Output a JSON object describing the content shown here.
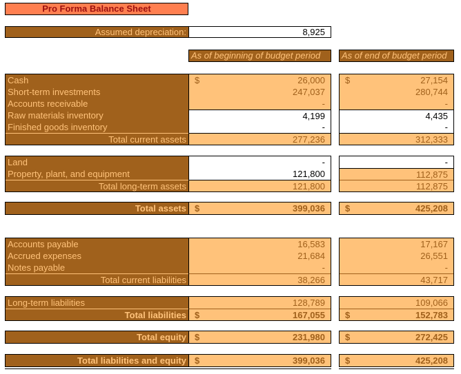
{
  "title": "Pro Forma Balance Sheet",
  "depreciation": {
    "label": "Assumed depreciation:",
    "value": "8,925"
  },
  "columns": [
    "As of beginning of budget period",
    "As of end of budget period"
  ],
  "currency": "$",
  "sections": {
    "current_assets": {
      "rows": [
        {
          "label": "Cash",
          "begin": "26,000",
          "end": "27,154",
          "currency": true
        },
        {
          "label": "Short-term investments",
          "begin": "247,037",
          "end": "280,744"
        },
        {
          "label": "Accounts receivable",
          "begin": "-",
          "end": "-"
        },
        {
          "label": "Raw materials inventory",
          "begin": "4,199",
          "end": "4,435",
          "input": true
        },
        {
          "label": "Finished goods inventory",
          "begin": "-",
          "end": "-",
          "input": true
        }
      ],
      "total": {
        "label": "Total current assets",
        "begin": "277,236",
        "end": "312,333"
      }
    },
    "long_term_assets": {
      "rows": [
        {
          "label": "Land",
          "begin": "-",
          "end": "-"
        },
        {
          "label": "Property, plant, and equipment",
          "begin": "121,800",
          "end": "112,875"
        }
      ],
      "total": {
        "label": "Total long-term assets",
        "begin": "121,800",
        "end": "112,875"
      }
    },
    "total_assets": {
      "label": "Total assets",
      "begin": "399,036",
      "end": "425,208"
    },
    "current_liabilities": {
      "rows": [
        {
          "label": "Accounts payable",
          "begin": "16,583",
          "end": "17,167"
        },
        {
          "label": "Accrued expenses",
          "begin": "21,684",
          "end": "26,551"
        },
        {
          "label": "Notes payable",
          "begin": "-",
          "end": "-"
        }
      ],
      "total": {
        "label": "Total current liabilities",
        "begin": "38,266",
        "end": "43,717"
      }
    },
    "long_term_liabilities": {
      "label": "Long-term liabilities",
      "begin": "128,789",
      "end": "109,066"
    },
    "total_liabilities": {
      "label": "Total liabilities",
      "begin": "167,055",
      "end": "152,783"
    },
    "total_equity": {
      "label": "Total equity",
      "begin": "231,980",
      "end": "272,425"
    },
    "total_liabilities_equity": {
      "label": "Total liabilities and equity",
      "begin": "399,036",
      "end": "425,208"
    }
  },
  "colors": {
    "header_brown": "#a0611c",
    "label_text": "#ffc27a",
    "value_fill": "#ffc27a",
    "title_fill": "#ff7f50",
    "title_text": "#9c1010"
  }
}
